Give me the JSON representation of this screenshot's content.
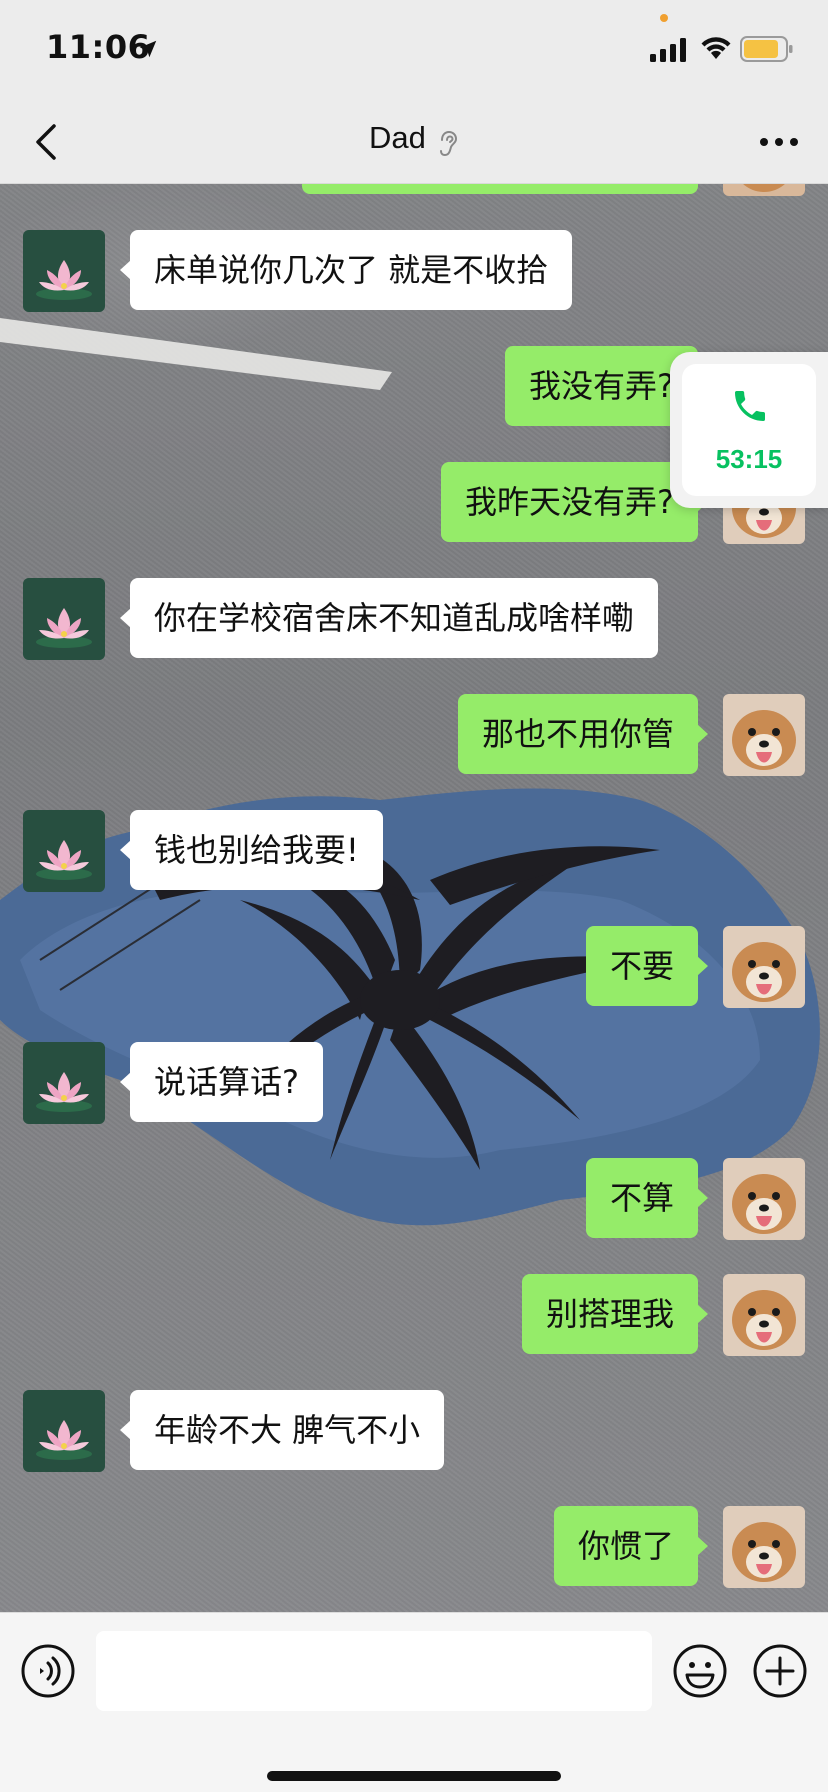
{
  "status_bar": {
    "time": "11:06"
  },
  "header": {
    "title": "Dad",
    "back_icon": "chevron-left-icon",
    "more_icon": "more-dots-icon",
    "ear_icon": "ear-icon"
  },
  "messages": [
    {
      "sender": "dad",
      "text": "床单说你几次了 就是不收拾"
    },
    {
      "sender": "me",
      "text": "我没有弄?"
    },
    {
      "sender": "me",
      "text": "我昨天没有弄?"
    },
    {
      "sender": "dad",
      "text": "你在学校宿舍床不知道乱成啥样嘞"
    },
    {
      "sender": "me",
      "text": "那也不用你管"
    },
    {
      "sender": "dad",
      "text": "钱也别给我要!"
    },
    {
      "sender": "me",
      "text": "不要"
    },
    {
      "sender": "dad",
      "text": "说话算话?"
    },
    {
      "sender": "me",
      "text": "不算"
    },
    {
      "sender": "me",
      "text": "别搭理我"
    },
    {
      "sender": "dad",
      "text": "年龄不大 脾气不小"
    },
    {
      "sender": "me",
      "text": "你惯了"
    }
  ],
  "call_widget": {
    "duration": "53:15",
    "icon": "phone-icon"
  },
  "input_bar": {
    "value": "",
    "voice_icon": "voice-icon",
    "emoji_icon": "emoji-icon",
    "plus_icon": "plus-icon"
  },
  "colors": {
    "my_bubble": "#95ec69",
    "their_bubble": "#ffffff",
    "call_green": "#07c160"
  }
}
